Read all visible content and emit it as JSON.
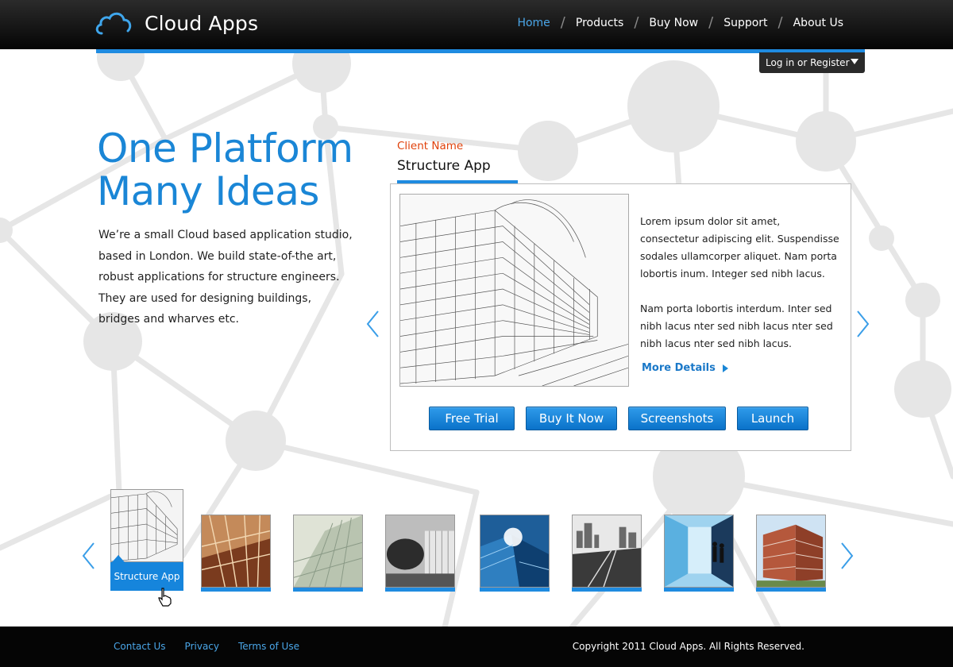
{
  "header": {
    "logo_text": "Cloud Apps",
    "nav": [
      {
        "label": "Home",
        "active": true
      },
      {
        "label": "Products",
        "active": false
      },
      {
        "label": "Buy Now",
        "active": false
      },
      {
        "label": "Support",
        "active": false
      },
      {
        "label": "About Us",
        "active": false
      }
    ],
    "login_label": "Log in or Register"
  },
  "hero": {
    "title_line1": "One Platform",
    "title_line2": "Many Ideas",
    "description": "We’re a small Cloud based application studio, based in London. We build state-of-the art, robust applications for structure engineers. They are used for designing buildings, bridges and wharves etc."
  },
  "showcase": {
    "client_label": "Client Name",
    "app_name": "Structure App",
    "paragraph1": "Lorem ipsum dolor sit amet, consectetur adipiscing elit. Suspendisse sodales ullamcorper aliquet. Nam porta lobortis inum. Integer sed nibh lacus.",
    "paragraph2": "Nam porta lobortis interdum. Inter sed nibh lacus nter sed nibh lacus nter sed nibh lacus nter sed nibh lacus.",
    "more_details": "More Details",
    "buttons": [
      "Free Trial",
      "Buy It Now",
      "Screenshots",
      "Launch"
    ]
  },
  "thumbnails": {
    "active_label": "Structure App",
    "count": 8
  },
  "footer": {
    "links": [
      "Contact Us",
      "Privacy",
      "Terms of Use"
    ],
    "copyright": "Copyright 2011 Cloud Apps. All Rights Reserved."
  },
  "colors": {
    "accent": "#1f8be0",
    "title_blue": "#1a86d6",
    "client_label": "#e0410a",
    "header_bg": "#050505"
  },
  "icons": {
    "logo": "cloud-icon",
    "prev": "chevron-left-icon",
    "next": "chevron-right-icon",
    "more": "triangle-right-icon",
    "login": "caret-down-icon"
  }
}
